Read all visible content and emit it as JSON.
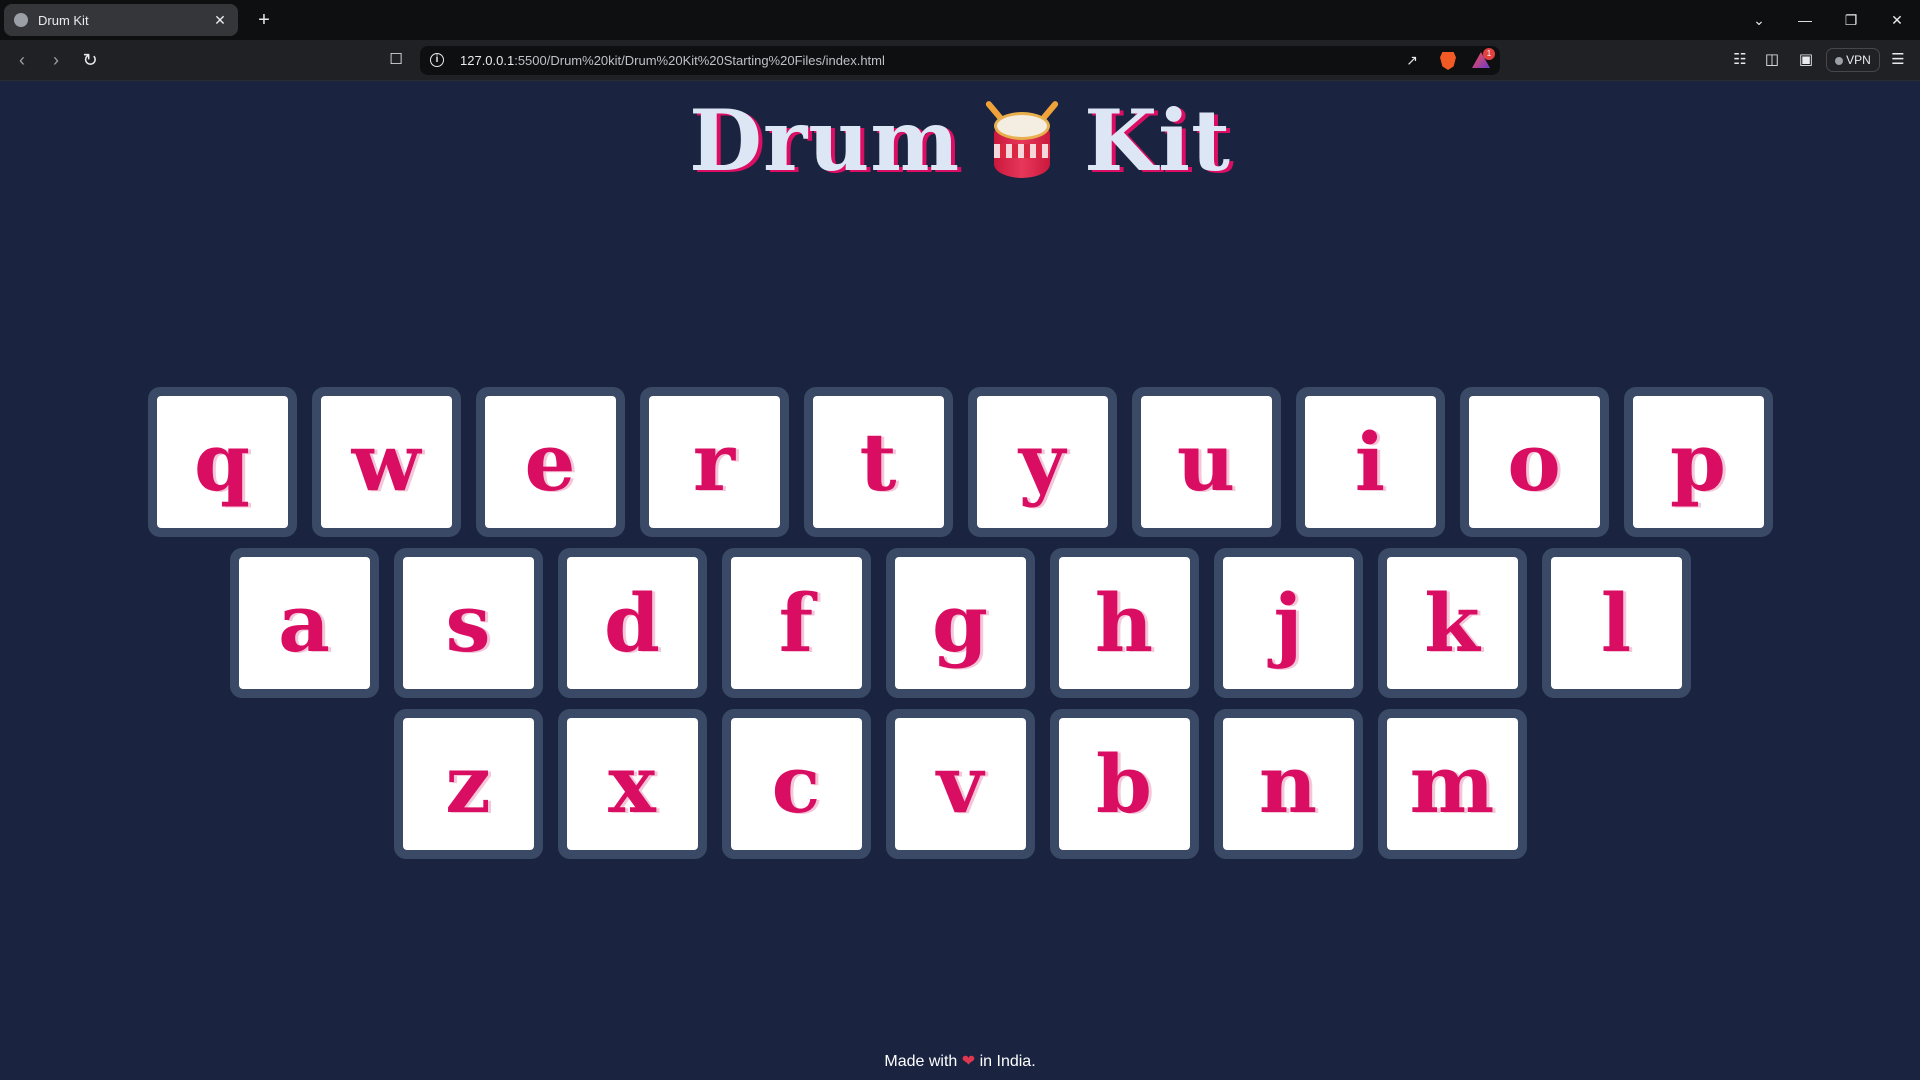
{
  "browser": {
    "tab_title": "Drum Kit",
    "tab_close": "✕",
    "new_tab": "+",
    "window_controls": [
      "⌄",
      "—",
      "❐",
      "✕"
    ],
    "url_host": "127.0.0.1",
    "url_path": ":5500/Drum%20kit/Drum%20Kit%20Starting%20Files/index.html",
    "vpn_label": "VPN",
    "notification_count": "1"
  },
  "page": {
    "title_left": "Drum",
    "title_right": "Kit",
    "rows": [
      [
        "q",
        "w",
        "e",
        "r",
        "t",
        "y",
        "u",
        "i",
        "o",
        "p"
      ],
      [
        "a",
        "s",
        "d",
        "f",
        "g",
        "h",
        "j",
        "k",
        "l"
      ],
      [
        "z",
        "x",
        "c",
        "v",
        "b",
        "n",
        "m"
      ]
    ],
    "footer_before": "Made with",
    "footer_heart": "❤",
    "footer_after": "in India."
  },
  "colors": {
    "background": "#1a2441",
    "key_letter": "#d90e63",
    "title_text": "#dde6f5",
    "title_shadow": "#db0e64"
  }
}
